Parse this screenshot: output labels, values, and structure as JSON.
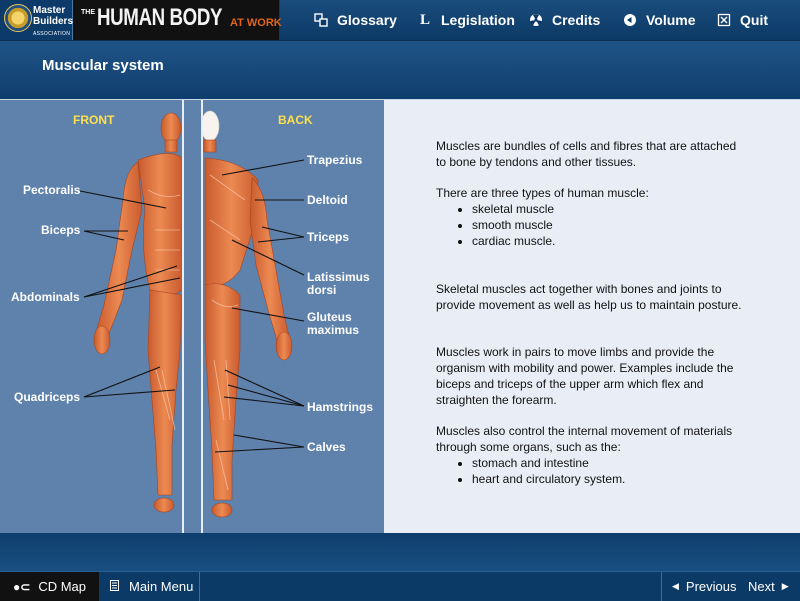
{
  "logo": {
    "line1": "Master",
    "line2": "Builders",
    "line3": "ASSOCIATION"
  },
  "app_title": {
    "prefix": "THE",
    "main": "HUMAN BODY",
    "suffix": "AT WORK"
  },
  "nav": {
    "glossary": "Glossary",
    "legislation": "Legislation",
    "credits": "Credits",
    "volume": "Volume",
    "quit": "Quit"
  },
  "page_title": "Muscular system",
  "diagram": {
    "front_label": "FRONT",
    "back_label": "BACK",
    "front_muscles": {
      "pectoralis": "Pectoralis",
      "biceps": "Biceps",
      "abdominals": "Abdominals",
      "quadriceps": "Quadriceps"
    },
    "back_muscles": {
      "trapezius": "Trapezius",
      "deltoid": "Deltoid",
      "triceps": "Triceps",
      "latissimus_1": "Latissimus",
      "latissimus_2": "dorsi",
      "gluteus_1": "Gluteus",
      "gluteus_2": "maximus",
      "hamstrings": "Hamstrings",
      "calves": "Calves"
    }
  },
  "content": {
    "p1": "Muscles are bundles of cells and fibres that are attached to bone by tendons and other tissues.",
    "p2": "There are three types of human muscle:",
    "types": [
      "skeletal muscle",
      "smooth muscle",
      "cardiac muscle."
    ],
    "p3": "Skeletal muscles act together with bones and joints to provide movement as well as help us to maintain posture.",
    "p4": "Muscles work in pairs to move limbs and provide the organism with mobility and power. Examples include the biceps and triceps of the upper arm which flex and straighten the forearm.",
    "p5": "Muscles also control the internal movement of materials through some organs, such as the:",
    "organs": [
      "stomach and intestine",
      "heart and circulatory system."
    ]
  },
  "footer": {
    "cd_map": "CD Map",
    "main_menu": "Main Menu",
    "previous": "Previous",
    "next": "Next"
  },
  "colors": {
    "muscle": "#e0733c",
    "muscle_dark": "#b9502a",
    "label_yellow": "#ffe04a",
    "panel_blue": "#5e82ac"
  }
}
